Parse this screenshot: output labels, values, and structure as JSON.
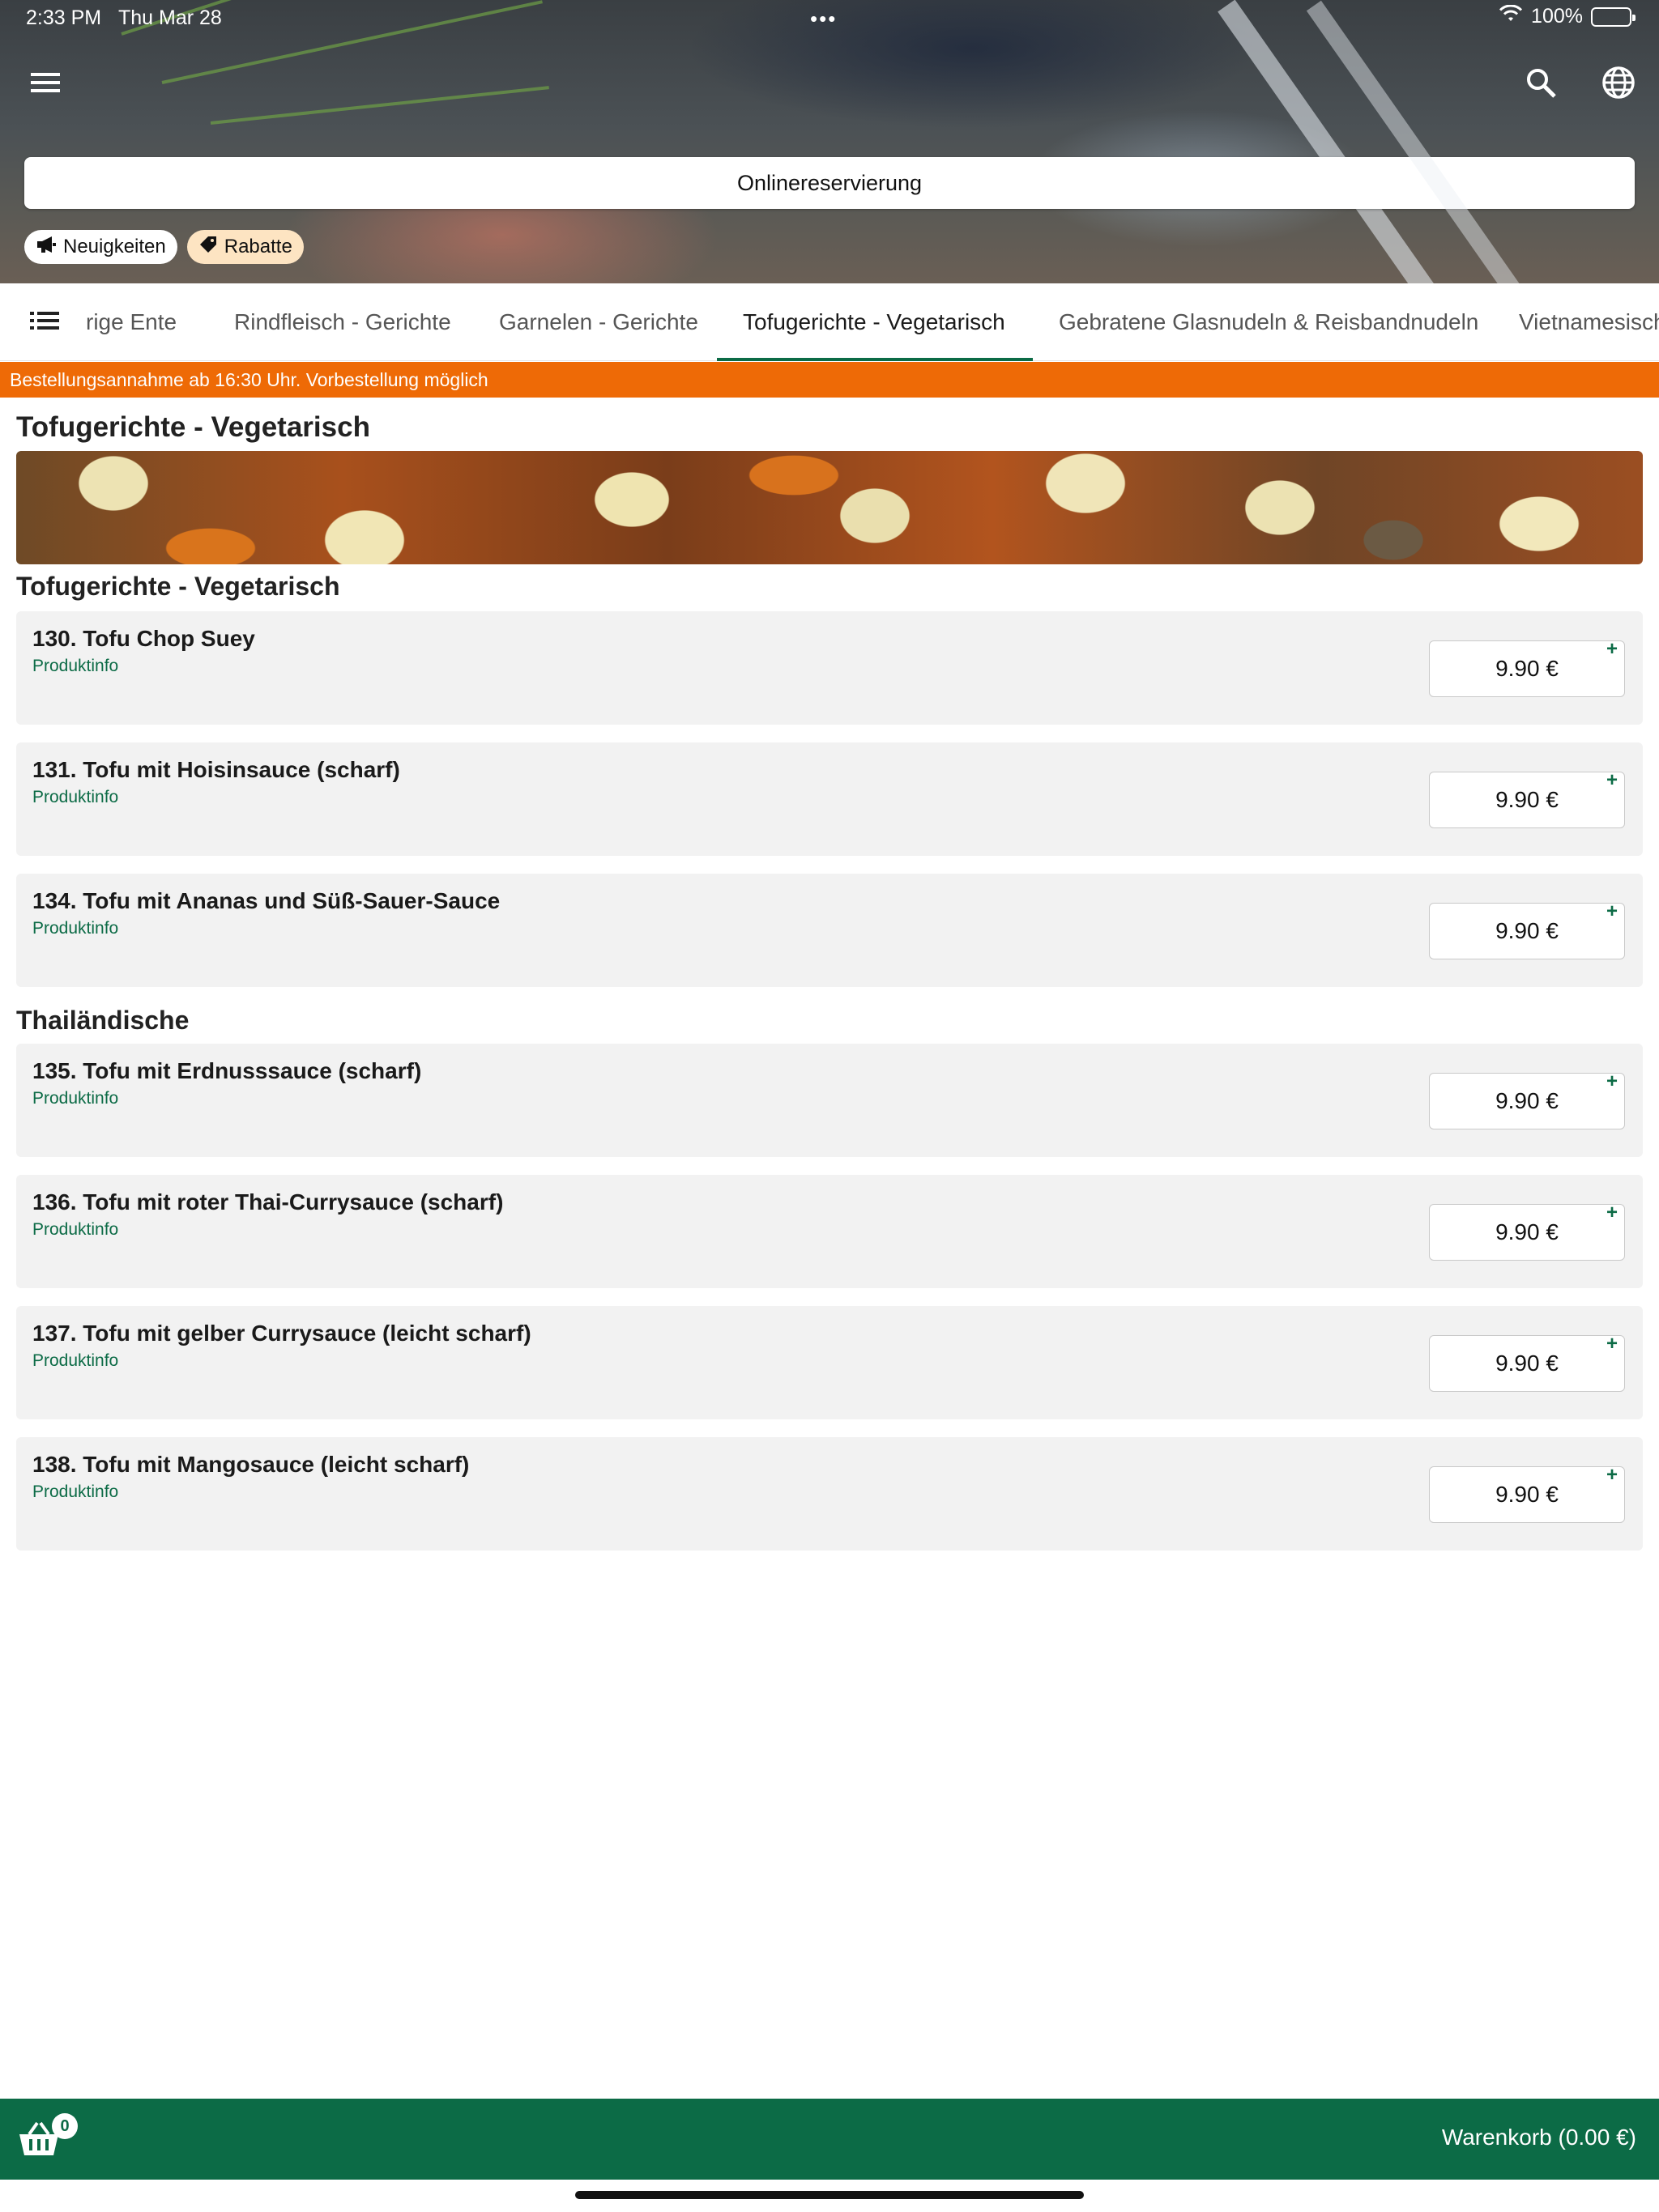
{
  "status_bar": {
    "time": "2:33 PM",
    "date": "Thu Mar 28",
    "dots": "•••",
    "battery": "100%"
  },
  "header": {
    "reservation_label": "Onlinereservierung",
    "chips": [
      {
        "label": "Neuigkeiten",
        "icon": "megaphone-icon"
      },
      {
        "label": "Rabatte",
        "icon": "tag-icon"
      }
    ]
  },
  "tabs": {
    "items": [
      {
        "label": "rige Ente"
      },
      {
        "label": "Rindfleisch - Gerichte"
      },
      {
        "label": "Garnelen - Gerichte"
      },
      {
        "label": "Tofugerichte - Vegetarisch",
        "active": true
      },
      {
        "label": "Gebratene Glasnudeln & Reisbandnudeln"
      },
      {
        "label": "Vietnamesisch"
      }
    ]
  },
  "notice": "Bestellungsannahme ab 16:30 Uhr. Vorbestellung möglich",
  "content": {
    "category_title": "Tofugerichte - Vegetarisch",
    "groups": [
      {
        "title": "Tofugerichte - Vegetarisch",
        "items": [
          {
            "name": "130. Tofu Chop Suey",
            "info": "Produktinfo",
            "price": "9.90 €"
          },
          {
            "name": "131. Tofu mit Hoisinsauce (scharf)",
            "info": "Produktinfo",
            "price": "9.90 €"
          },
          {
            "name": "134. Tofu mit Ananas und Süß-Sauer-Sauce",
            "info": "Produktinfo",
            "price": "9.90 €"
          }
        ]
      },
      {
        "title": "Thailändische",
        "items": [
          {
            "name": "135. Tofu mit Erdnusssauce (scharf)",
            "info": "Produktinfo",
            "price": "9.90 €"
          },
          {
            "name": "136. Tofu mit roter Thai-Currysauce (scharf)",
            "info": "Produktinfo",
            "price": "9.90 €"
          },
          {
            "name": "137. Tofu mit gelber Currysauce (leicht scharf)",
            "info": "Produktinfo",
            "price": "9.90 €"
          },
          {
            "name": "138. Tofu mit Mangosauce (leicht scharf)",
            "info": "Produktinfo",
            "price": "9.90 €"
          }
        ]
      }
    ],
    "add_symbol": "+"
  },
  "cart": {
    "count": "0",
    "label": "Warenkorb (0.00 €)"
  },
  "colors": {
    "brand_green": "#0c6b46",
    "notice_orange": "#ee6a06",
    "discount_chip": "#fde4c2"
  }
}
